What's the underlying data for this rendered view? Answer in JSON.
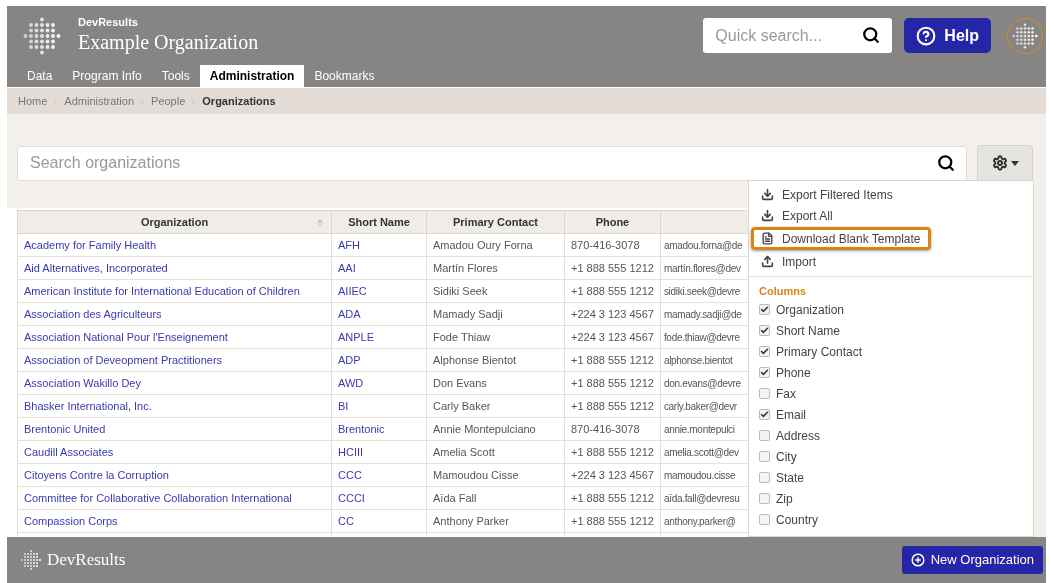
{
  "header": {
    "brand": "DevResults",
    "organization": "Example Organization",
    "quick_search": {
      "placeholder": "Quick search..."
    },
    "help_button": "Help"
  },
  "tabs": [
    {
      "label": "Data",
      "selected": false
    },
    {
      "label": "Program Info",
      "selected": false
    },
    {
      "label": "Tools",
      "selected": false
    },
    {
      "label": "Administration",
      "selected": true
    },
    {
      "label": "Bookmarks",
      "selected": false
    }
  ],
  "breadcrumb": [
    "Home",
    "Administration",
    "People",
    "Organizations"
  ],
  "search": {
    "placeholder": "Search organizations"
  },
  "table": {
    "columns": [
      {
        "label": "Organization",
        "sorted": true
      },
      {
        "label": "Short Name",
        "sorted": false
      },
      {
        "label": "Primary Contact",
        "sorted": false
      },
      {
        "label": "Phone",
        "sorted": false
      }
    ],
    "rows": [
      [
        "Academy for Family Health",
        "AFH",
        "Amadou Oury Forna",
        "870-416-3078",
        "amadou.forna@de"
      ],
      [
        "Aid Alternatives, Incorporated",
        "AAI",
        "Martín Flores",
        "+1 888 555 1212",
        "martín.flores@dev"
      ],
      [
        "American Institute for International Education of Children",
        "AIIEC",
        "Sidiki Seek",
        "+1 888 555 1212",
        "sidiki.seek@devre"
      ],
      [
        "Association des Agriculteurs",
        "ADA",
        "Mamady Sadji",
        "+224 3 123 4567",
        "mamady.sadji@de"
      ],
      [
        "Association National Pour l'Enseignement",
        "ANPLE",
        "Fode Thiaw",
        "+224 3 123 4567",
        "fode.thiaw@devre"
      ],
      [
        "Association of Deveopment Practitioners",
        "ADP",
        "Alphonse Bientot",
        "+1 888 555 1212",
        "alphonse.bientot"
      ],
      [
        "Association Wakillo Dey",
        "AWD",
        "Don Evans",
        "+1 888 555 1212",
        "don.evans@devre"
      ],
      [
        "Bhasker International, Inc.",
        "BI",
        "Carly Baker",
        "+1 888 555 1212",
        "carly.baker@devr"
      ],
      [
        "Brentonic United",
        "Brentonic",
        "Annie Montepulciano",
        "870-416-3078",
        "annie.montepulci"
      ],
      [
        "Caudill Associates",
        "HCIII",
        "Amelia Scott",
        "+1 888 555 1212",
        "amelia.scott@dev"
      ],
      [
        "Citoyens Contre la Corruption",
        "CCC",
        "Mamoudou Cisse",
        "+224 3 123 4567",
        "mamoudou.cisse"
      ],
      [
        "Committee for Collaborative Collaboration International",
        "CCCI",
        "Aïda Fall",
        "+1 888 555 1212",
        "aïda.fall@devresu"
      ],
      [
        "Compassion Corps",
        "CC",
        "Anthony Parker",
        "+1 888 555 1212",
        "anthony.parker@"
      ]
    ]
  },
  "menu": {
    "items": [
      {
        "label": "Export Filtered Items",
        "kind": "download",
        "highlighted": false
      },
      {
        "label": "Export All",
        "kind": "download",
        "highlighted": false
      },
      {
        "label": "Download Blank Template",
        "kind": "file",
        "highlighted": true
      },
      {
        "label": "Import",
        "kind": "upload",
        "highlighted": false
      }
    ],
    "columns_heading": "Columns",
    "columns": [
      {
        "label": "Organization",
        "checked": true
      },
      {
        "label": "Short Name",
        "checked": true
      },
      {
        "label": "Primary Contact",
        "checked": true
      },
      {
        "label": "Phone",
        "checked": true
      },
      {
        "label": "Fax",
        "checked": false
      },
      {
        "label": "Email",
        "checked": true
      },
      {
        "label": "Address",
        "checked": false
      },
      {
        "label": "City",
        "checked": false
      },
      {
        "label": "State",
        "checked": false
      },
      {
        "label": "Zip",
        "checked": false
      },
      {
        "label": "Country",
        "checked": false
      }
    ]
  },
  "footer": {
    "brand": "DevResults",
    "new_button": "New Organization"
  }
}
